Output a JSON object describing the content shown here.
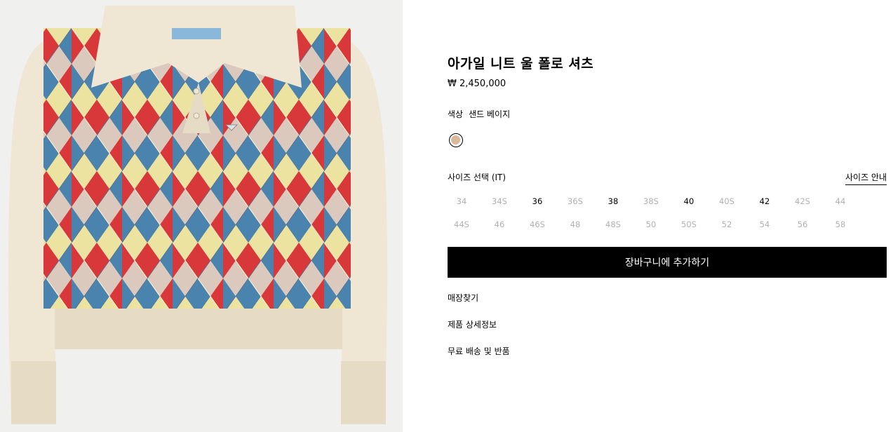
{
  "product": {
    "title": "아가일 니트 울 폴로 셔츠",
    "price": "₩ 2,450,000",
    "image_alt": "product-photo-argyle-polo"
  },
  "color": {
    "label": "색상",
    "value": "샌드 베이지",
    "swatch_hex": "#d9b99a"
  },
  "size": {
    "label": "사이즈 선택 (IT)",
    "guide_label": "사이즈 안내",
    "rows": [
      [
        {
          "label": "34",
          "available": false
        },
        {
          "label": "34S",
          "available": false
        },
        {
          "label": "36",
          "available": true
        },
        {
          "label": "36S",
          "available": false
        },
        {
          "label": "38",
          "available": true
        },
        {
          "label": "38S",
          "available": false
        },
        {
          "label": "40",
          "available": true
        },
        {
          "label": "40S",
          "available": false
        },
        {
          "label": "42",
          "available": true
        },
        {
          "label": "42S",
          "available": false
        },
        {
          "label": "44",
          "available": false
        }
      ],
      [
        {
          "label": "44S",
          "available": false
        },
        {
          "label": "46",
          "available": false
        },
        {
          "label": "46S",
          "available": false
        },
        {
          "label": "48",
          "available": false
        },
        {
          "label": "48S",
          "available": false
        },
        {
          "label": "50",
          "available": false
        },
        {
          "label": "50S",
          "available": false
        },
        {
          "label": "52",
          "available": false
        },
        {
          "label": "54",
          "available": false
        },
        {
          "label": "56",
          "available": false
        },
        {
          "label": "58",
          "available": false
        }
      ]
    ]
  },
  "actions": {
    "add_to_cart": "장바구니에 추가하기",
    "find_store": "매장찾기",
    "details": "제품 상세정보",
    "shipping": "무료 배송 및 반품"
  },
  "colors": {
    "argyle_red": "#d8383a",
    "argyle_blue": "#4a83ad",
    "argyle_yellow": "#ece3a0",
    "argyle_pink": "#dcc9bd",
    "knit_cream": "#efe6d4",
    "label_blue": "#8ab8da"
  }
}
